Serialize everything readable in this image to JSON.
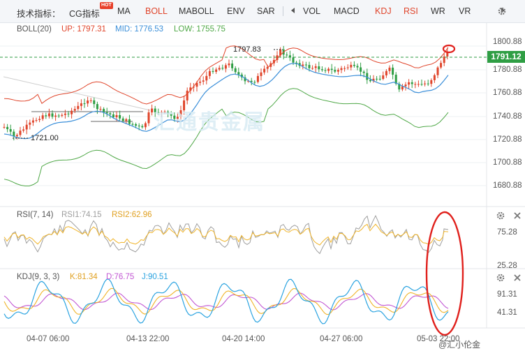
{
  "toolbar": {
    "label": "技术指标：",
    "hot_badge": "HOT",
    "items": [
      "CG指标",
      "MA",
      "BOLL",
      "MABOLL",
      "ENV",
      "SAR",
      "VOL",
      "MACD",
      "KDJ",
      "RSI",
      "WR",
      "VR"
    ]
  },
  "boll_legend": {
    "name": "BOLL(20)",
    "up": "UP: 1797.31",
    "mid": "MID: 1776.53",
    "low": "LOW: 1755.75"
  },
  "rsi_legend": {
    "name": "RSI(7, 14)",
    "rsi1": "RSI1:74.15",
    "rsi2": "RSI2:62.96"
  },
  "kdj_legend": {
    "name": "KDJ(9, 3, 3)",
    "k": "K:81.34",
    "d": "D:76.75",
    "j": "J:90.51"
  },
  "price_axis": [
    "1800.88",
    "1780.88",
    "1760.88",
    "1740.88",
    "1720.88",
    "1700.88",
    "1680.88"
  ],
  "rsi_axis": [
    "75.28",
    "25.28"
  ],
  "kdj_axis": [
    "91.31",
    "41.31"
  ],
  "time_axis": [
    "04-07 06:00",
    "04-13 22:00",
    "04-20 14:00",
    "04-27 06:00",
    "05-03 22:00"
  ],
  "current_price": "1791.12",
  "high_label": "1797.83",
  "low_label": "1721.00",
  "watermark": "汇通贵金属",
  "wm_footer": "@汇小伦金",
  "colors": {
    "up": "#e0452b",
    "down": "#2f9e44",
    "mid": "#3b8fd9",
    "low": "#4fa847",
    "rsi1": "#9e9e9e",
    "rsi2": "#f0b429",
    "k": "#f0b429",
    "d": "#c257d3",
    "j": "#2aa3e0",
    "circle": "#e0201c"
  }
}
